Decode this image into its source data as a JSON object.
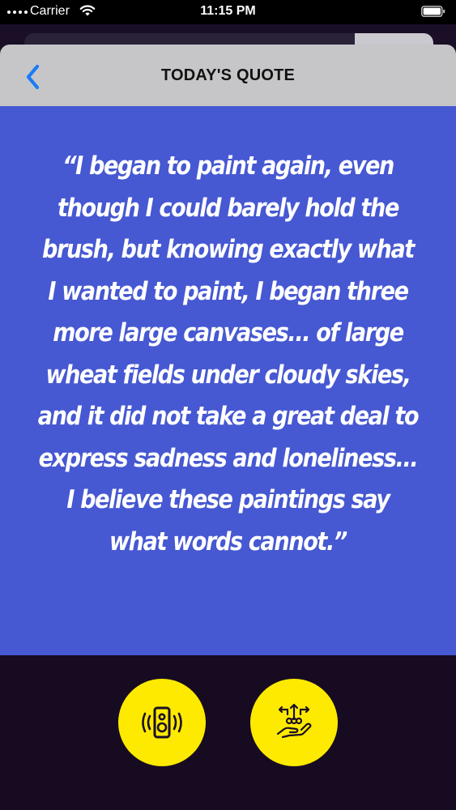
{
  "status_bar": {
    "carrier": "Carrier",
    "time": "11:15 PM",
    "icons": [
      "wifi-icon",
      "battery-icon"
    ]
  },
  "nav": {
    "title": "TODAY'S QUOTE",
    "back_icon": "chevron-left-icon",
    "accent_color": "#1a7cf5"
  },
  "quote": {
    "text": "“I began to paint again, even though I could barely hold the brush, but knowing exactly what I wanted to paint, I began three more large canvases... of large wheat fields under cloudy skies, and it did not take a great deal to express sadness and loneliness... I believe these paintings say what words cannot.”",
    "background_color": "#4658d2",
    "text_color": "#ffffff"
  },
  "actions": [
    {
      "name": "speaker-button",
      "icon": "speaker-icon",
      "color": "#fdea00"
    },
    {
      "name": "gesture-button",
      "icon": "hand-gesture-icon",
      "color": "#fdea00"
    }
  ]
}
